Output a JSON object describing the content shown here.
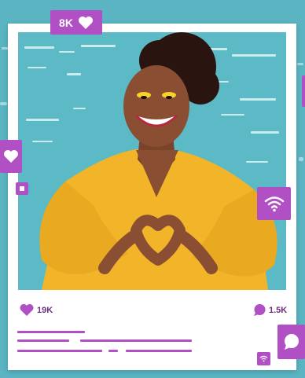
{
  "top_badge": {
    "count": "8K",
    "icon": "heart-icon"
  },
  "post": {
    "likes": {
      "count": "19K",
      "icon": "heart-icon"
    },
    "comments": {
      "count": "1.5K",
      "icon": "comment-icon"
    }
  },
  "floating_badges": [
    {
      "icon": "heart-icon"
    },
    {
      "icon": "wifi-icon"
    },
    {
      "icon": "chat-bubble-icon"
    },
    {
      "icon": "wifi-icon"
    }
  ],
  "colors": {
    "accent": "#b14fc5",
    "background": "#5ab4c2",
    "photo_bg": "#5cb9c6",
    "shirt": "#f2b52a",
    "skin": "#8a4f33",
    "text": "#6b2f80"
  }
}
